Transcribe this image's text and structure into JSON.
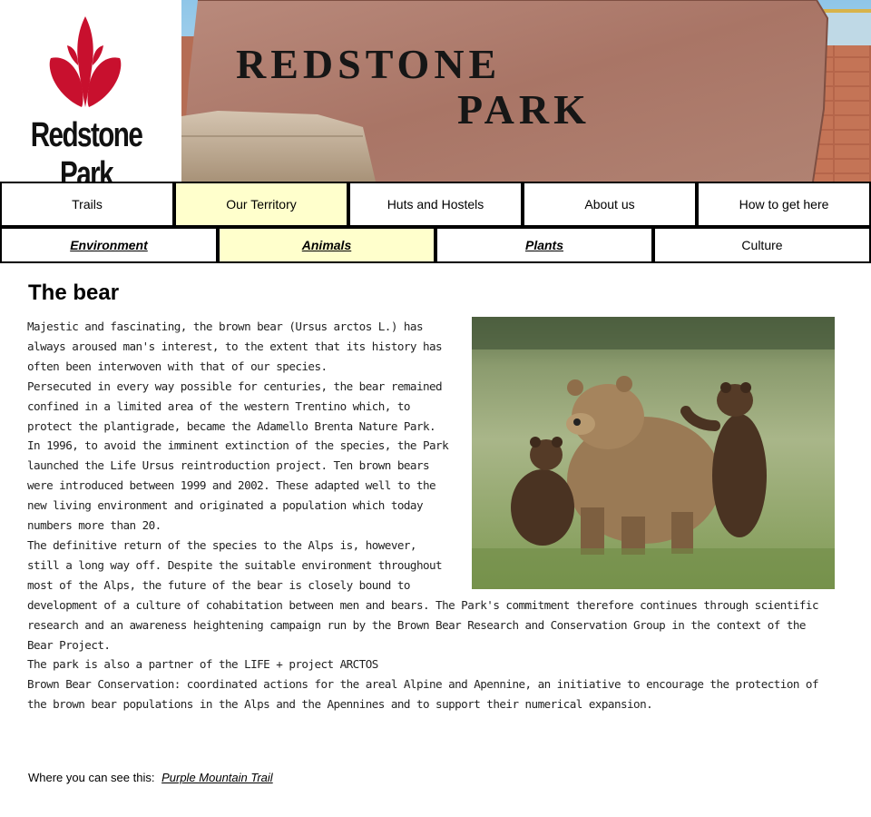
{
  "header": {
    "logo_text": "Redstone Park",
    "banner_line1": "REDSTONE",
    "banner_line2": "PARK"
  },
  "nav_primary": [
    {
      "label": "Trails",
      "active": false
    },
    {
      "label": "Our Territory",
      "active": true
    },
    {
      "label": "Huts and Hostels",
      "active": false
    },
    {
      "label": "About us",
      "active": false
    },
    {
      "label": "How to get here",
      "active": false
    }
  ],
  "nav_secondary": [
    {
      "label": "Environment",
      "active": false
    },
    {
      "label": "Animals",
      "active": true
    },
    {
      "label": "Plants",
      "active": false
    },
    {
      "label": "Culture",
      "active": false
    }
  ],
  "article": {
    "title": "The bear",
    "paragraphs": [
      "Majestic and fascinating, the brown bear (Ursus arctos L.) has always aroused man's interest, to the extent that its history has often been interwoven with that of our species.",
      "Persecuted in every way possible for centuries, the bear remained confined in a limited area of the western Trentino which, to protect the plantigrade, became the Adamello Brenta Nature Park.",
      "In 1996, to avoid the imminent extinction of the species, the Park launched the Life Ursus reintroduction project. Ten brown bears were introduced between 1999 and 2002. These adapted well to the new living environment and originated a population which today numbers more than 20.",
      "The definitive return of the species to the Alps is, however, still a long way off. Despite the suitable environment throughout most of the Alps, the future of the bear is closely bound to development of a culture of cohabitation between men and bears. The Park's commitment therefore continues through scientific research and an awareness heightening campaign run by the Brown Bear Research and Conservation Group in the context of the Bear Project.",
      "The park is also a partner of the LIFE + project ARCTOS",
      "Brown Bear Conservation: coordinated actions for the areal Alpine and Apennine, an initiative to encourage the protection of the brown bear populations in the Alps and the Apennines and to support their numerical expansion."
    ]
  },
  "where": {
    "label": "Where you can see this:",
    "link": "Purple Mountain Trail"
  },
  "colors": {
    "active_tab": "#ffffcc",
    "logo_red": "#c8102e",
    "border": "#000000"
  }
}
